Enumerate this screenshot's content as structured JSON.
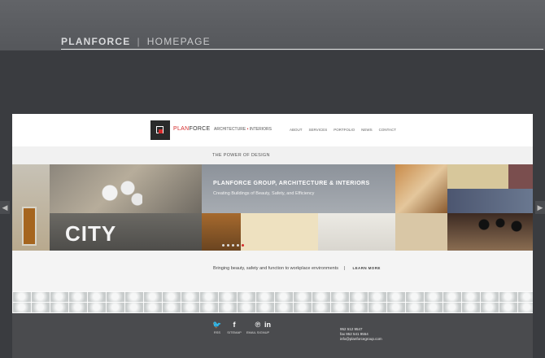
{
  "page_title": {
    "brand": "PLANFORCE",
    "separator": "|",
    "section": "HOMEPAGE"
  },
  "site": {
    "logo_prefix": "PLAN",
    "logo_suffix": "FORCE",
    "tagline_left": "ARCHITECTURE",
    "tagline_dot": "•",
    "tagline_right": "INTERIORS",
    "nav": [
      "ABOUT",
      "SERVICES",
      "PORTFOLIO",
      "NEWS",
      "CONTACT"
    ],
    "power_text": "THE POWER OF DESIGN",
    "hero_heading": "PLANFORCE GROUP, ARCHITECTURE & INTERIORS",
    "hero_subheading": "Creating Buildings of Beauty, Safety, and Efficiency",
    "city_sign": "CITY",
    "slider_active_index": 4,
    "slider_count": 5,
    "bring_text": "Bringing beauty, safety and function to workplace environments",
    "bring_sep": "|",
    "learn_more": "LEARN MORE",
    "footer": {
      "social": [
        {
          "icon": "twitter-icon",
          "glyph": "🐦",
          "label": "RSS"
        },
        {
          "icon": "facebook-icon",
          "glyph": "f",
          "label": "SITEMAP"
        },
        {
          "icon": "pinterest-icon",
          "glyph": "℗",
          "label": "EMAIL SIGNUP"
        },
        {
          "icon": "linkedin-icon",
          "glyph": "in",
          "label": ""
        }
      ],
      "phone": "952 512 9547",
      "fax": "fax 952 541 9554",
      "email": "info@planforcegroup.com"
    }
  },
  "colors": {
    "accent_red": "#d42a2a",
    "frame_dark": "#3a3c40",
    "footer_gray": "#4a4b4e"
  }
}
